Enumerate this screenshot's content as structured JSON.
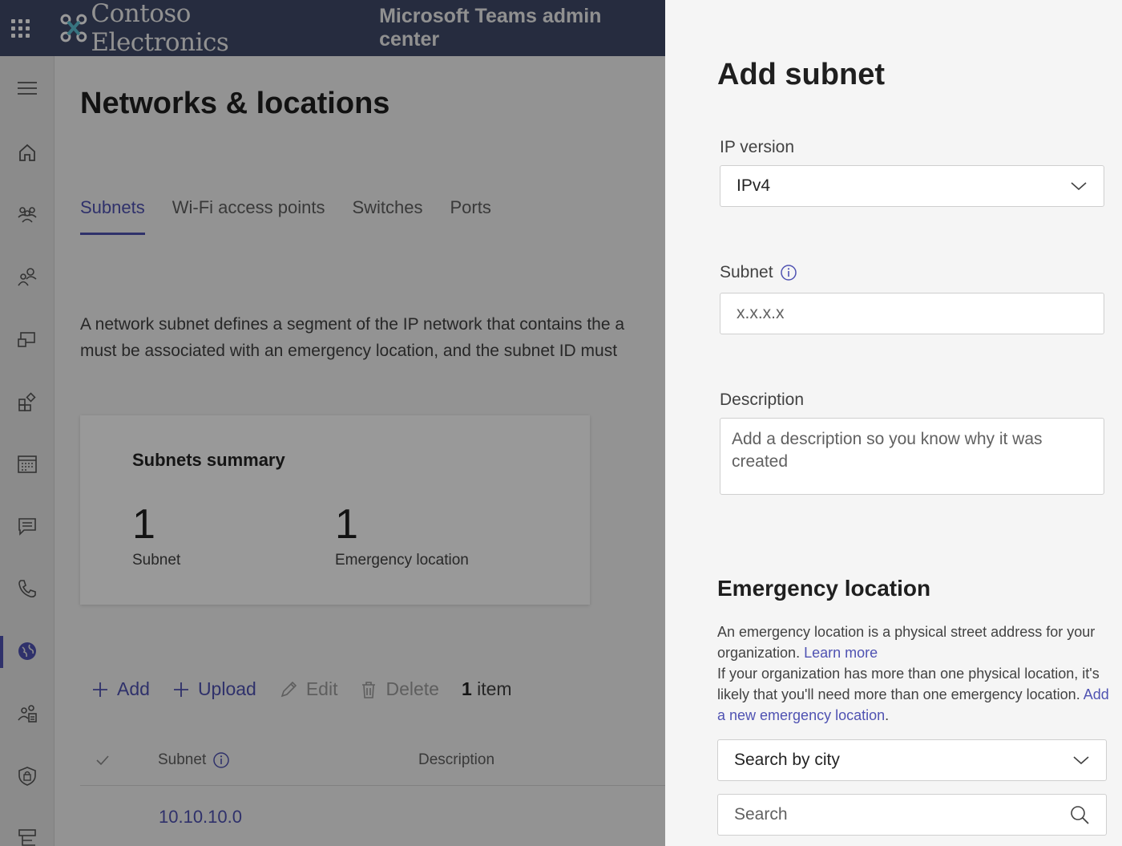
{
  "topbar": {
    "brand_name": "Contoso Electronics",
    "app_title": "Microsoft Teams admin center",
    "brand_color": "#404a6a"
  },
  "rail": {
    "items": [
      {
        "icon": "hamburger-icon"
      },
      {
        "icon": "home-icon"
      },
      {
        "icon": "teams-icon"
      },
      {
        "icon": "users-icon"
      },
      {
        "icon": "devices-icon"
      },
      {
        "icon": "apps-icon"
      },
      {
        "icon": "meetings-icon"
      },
      {
        "icon": "messaging-icon"
      },
      {
        "icon": "voice-icon"
      },
      {
        "icon": "locations-icon",
        "active": true
      },
      {
        "icon": "guest-users-icon"
      },
      {
        "icon": "security-icon"
      },
      {
        "icon": "planning-icon"
      }
    ]
  },
  "main": {
    "title": "Networks & locations",
    "tabs": [
      {
        "label": "Subnets",
        "active": true
      },
      {
        "label": "Wi-Fi access points"
      },
      {
        "label": "Switches"
      },
      {
        "label": "Ports"
      }
    ],
    "intro_line1": "A network subnet defines a segment of the IP network that contains the a",
    "intro_line2": "must be associated with an emergency location, and the subnet ID must ",
    "summary": {
      "title": "Subnets summary",
      "stats": [
        {
          "value": "1",
          "label": "Subnet"
        },
        {
          "value": "1",
          "label": "Emergency location"
        }
      ]
    },
    "toolbar": {
      "add": "Add",
      "upload": "Upload",
      "edit": "Edit",
      "delete": "Delete",
      "count_num": "1",
      "count_label": "item"
    },
    "table": {
      "headers": {
        "subnet": "Subnet",
        "description": "Description"
      },
      "rows": [
        {
          "subnet": "10.10.10.0"
        }
      ]
    }
  },
  "panel": {
    "title": "Add subnet",
    "ip_version_label": "IP version",
    "ip_version_value": "IPv4",
    "subnet_label": "Subnet",
    "subnet_placeholder": "x.x.x.x",
    "description_label": "Description",
    "description_placeholder": "Add a description so you know why it was created",
    "emergency": {
      "title": "Emergency location",
      "text1": "An emergency location is a physical street address for your organization. ",
      "learn_more": "Learn more",
      "text2": "If your organization has more than one physical location, it's likely that you'll need more than one emergency location. ",
      "add_new_link": "Add a new emergency location",
      "text3": "."
    },
    "search_by": "Search by city",
    "search_placeholder": "Search"
  },
  "colors": {
    "accent": "#4f52b2"
  }
}
